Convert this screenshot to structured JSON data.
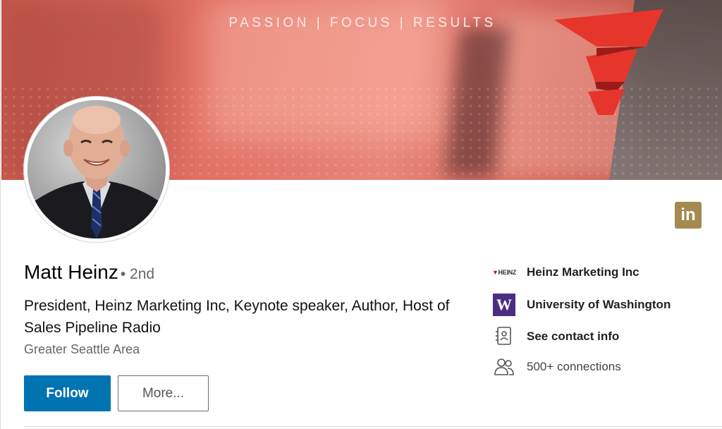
{
  "banner": {
    "tagline": "PASSION | FOCUS | RESULTS"
  },
  "profile": {
    "name": "Matt Heinz",
    "degree": "• 2nd",
    "headline": "President, Heinz Marketing Inc, Keynote speaker, Author, Host of Sales Pipeline Radio",
    "location": "Greater Seattle Area"
  },
  "actions": {
    "follow_label": "Follow",
    "more_label": "More..."
  },
  "info": {
    "company_logo_text": "HEINZ",
    "company": "Heinz Marketing Inc",
    "school_logo_text": "W",
    "school": "University of Washington",
    "contact": "See contact info",
    "connections": "500+ connections"
  },
  "brand": {
    "linkedin_icon_text": "in",
    "linkedin_color": "#a48a50",
    "follow_color": "#0073b1",
    "uw_purple": "#4b2e83",
    "banner_red": "#e07062"
  },
  "icons": [
    "linkedin-icon",
    "heinz-logo-icon",
    "uw-logo-icon",
    "contact-card-icon",
    "connections-icon"
  ]
}
